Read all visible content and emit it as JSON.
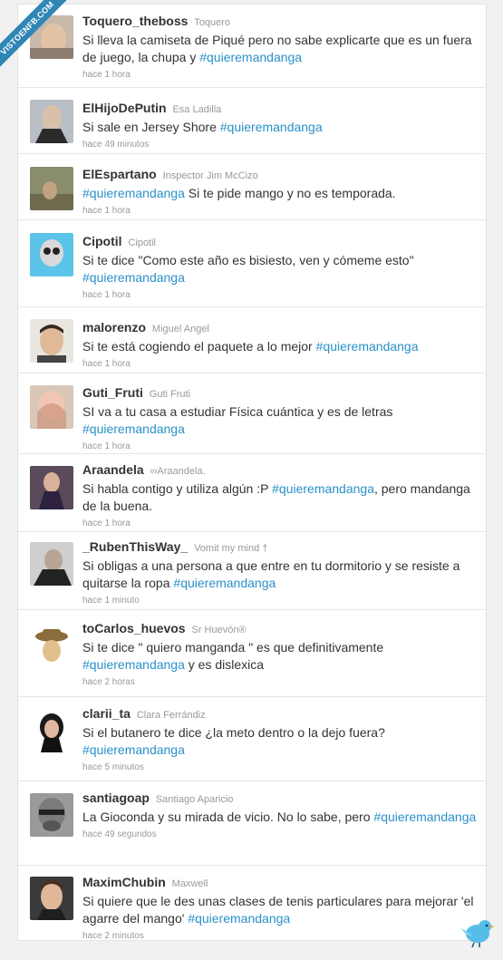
{
  "watermark": "VISTOENFB.COM",
  "colors": {
    "hashtag": "#2a90c8",
    "username": "#333333",
    "meta": "#999999",
    "watermark": "#2f86b5",
    "bird": "#55bde8"
  },
  "tweets": [
    {
      "username": "Toquero_theboss",
      "fullname": "Toquero",
      "text": "Si lleva la camiseta de Piqué pero no sabe explicarte que es un fuera de juego, la chupa y",
      "hashtag": "#quieremandanga",
      "time": "hace 1 hora"
    },
    {
      "username": "ElHijoDePutin",
      "fullname": "Esa Ladilla",
      "text": "Si sale en Jersey Shore",
      "hashtag": "#quieremandanga",
      "time": "hace 49 minutos"
    },
    {
      "username": "ElEspartano",
      "fullname": "Inspector Jim McCizo",
      "text_pre": "",
      "hashtag": "#quieremandanga",
      "text": "Si te pide mango y no es temporada.",
      "time": "hace 1 hora"
    },
    {
      "username": "Cipotil",
      "fullname": "Cipotil",
      "text": "Si te dice \"Como este año es bisiesto, ven y cómeme esto\"",
      "hashtag": "#quieremandanga",
      "time": "hace 1 hora"
    },
    {
      "username": "malorenzo",
      "fullname": "Miguel Angel",
      "text": "Si te está cogiendo el paquete a lo mejor",
      "hashtag": "#quieremandanga",
      "time": "hace 1 hora"
    },
    {
      "username": "Guti_Fruti",
      "fullname": "Guti Fruti",
      "text": "SI va a tu casa a estudiar Física cuántica y es de letras",
      "hashtag": "#quieremandanga",
      "time": "hace 1 hora"
    },
    {
      "username": "Araandela",
      "fullname": "∞Araandela.",
      "text": "Si habla contigo y utiliza algún :P",
      "hashtag": "#quieremandanga",
      "text_post": ", pero mandanga de la buena.",
      "time": "hace 1 hora"
    },
    {
      "username": "_RubenThisWay_",
      "fullname": "Vomit my mind †",
      "text": "Si obligas a una persona a que entre en tu dormitorio y se resiste a quitarse la ropa",
      "hashtag": "#quieremandanga",
      "time": "hace 1 minuto"
    },
    {
      "username": "toCarlos_huevos",
      "fullname": "Sr Huevón®",
      "text": "Si te dice \" quiero manganda \" es que definitivamente",
      "hashtag": "#quieremandanga",
      "text_post": " y es dislexica",
      "time": "hace 2 horas"
    },
    {
      "username": "clarii_ta",
      "fullname": "Clara Ferrándiz",
      "text": "Si el butanero te dice ¿la meto dentro o la dejo fuera?",
      "hashtag": "#quieremandanga",
      "time": "hace 5 minutos"
    },
    {
      "username": "santiagoap",
      "fullname": "Santiago Aparicio",
      "text": "La Gioconda y su mirada de vicio. No lo sabe, pero",
      "hashtag": "#quieremandanga",
      "time": "hace 49 segundos"
    },
    {
      "username": "MaximChubin",
      "fullname": "Maxwell",
      "text": "Si quiere que le des unas clases de tenis particulares para mejorar 'el agarre del mango'",
      "hashtag": "#quieremandanga",
      "time": "hace 2 minutos"
    }
  ],
  "icons": {
    "bird": "twitter-bird-icon"
  }
}
